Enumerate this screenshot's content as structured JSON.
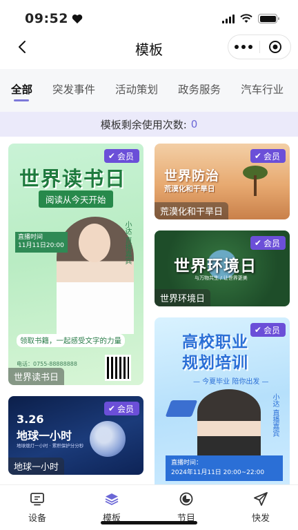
{
  "status_bar": {
    "time": "09:52"
  },
  "nav": {
    "title": "模板"
  },
  "tabs": [
    {
      "label": "全部",
      "active": true
    },
    {
      "label": "突发事件"
    },
    {
      "label": "活动策划"
    },
    {
      "label": "政务服务"
    },
    {
      "label": "汽车行业"
    }
  ],
  "remain": {
    "label": "模板剩余使用次数:",
    "count": "0"
  },
  "badge_label": "会员",
  "cards": {
    "reading": {
      "label": "世界读书日",
      "headline": "世界读书日",
      "sub": "阅读从今天开始",
      "live_title": "直播时间",
      "live_time": "11月11日20:00",
      "vertical": "小达 直播嘉宾",
      "slogan": "领取书籍，一起感受文字的力量",
      "contact": "电话：0755-88888888"
    },
    "desert": {
      "label": "荒漠化和干旱日",
      "headline": "世界防治",
      "sub": "荒漠化和干旱日"
    },
    "environment": {
      "label": "世界环境日",
      "headline": "世界环境日",
      "sub": "与万物共生 / 让世界更美"
    },
    "earth_hour": {
      "label": "地球一小时",
      "date": "3.26",
      "headline": "地球一小时",
      "sub": "地球熄灯一小时 · 累积保护分分秒"
    },
    "career": {
      "headline_1": "高校职业",
      "headline_2": "规划培训",
      "sub": "— 今夏毕业 陪你出发 —",
      "vertical": "小达 直播嘉宾",
      "live_title": "直播时间：",
      "live_time": "2024年11月11日 20:00~22:00"
    }
  },
  "bottom_tabs": [
    {
      "label": "设备",
      "icon": "monitor-icon"
    },
    {
      "label": "模板",
      "icon": "layers-icon",
      "active": true
    },
    {
      "label": "节目",
      "icon": "program-icon"
    },
    {
      "label": "快发",
      "icon": "send-icon"
    }
  ]
}
